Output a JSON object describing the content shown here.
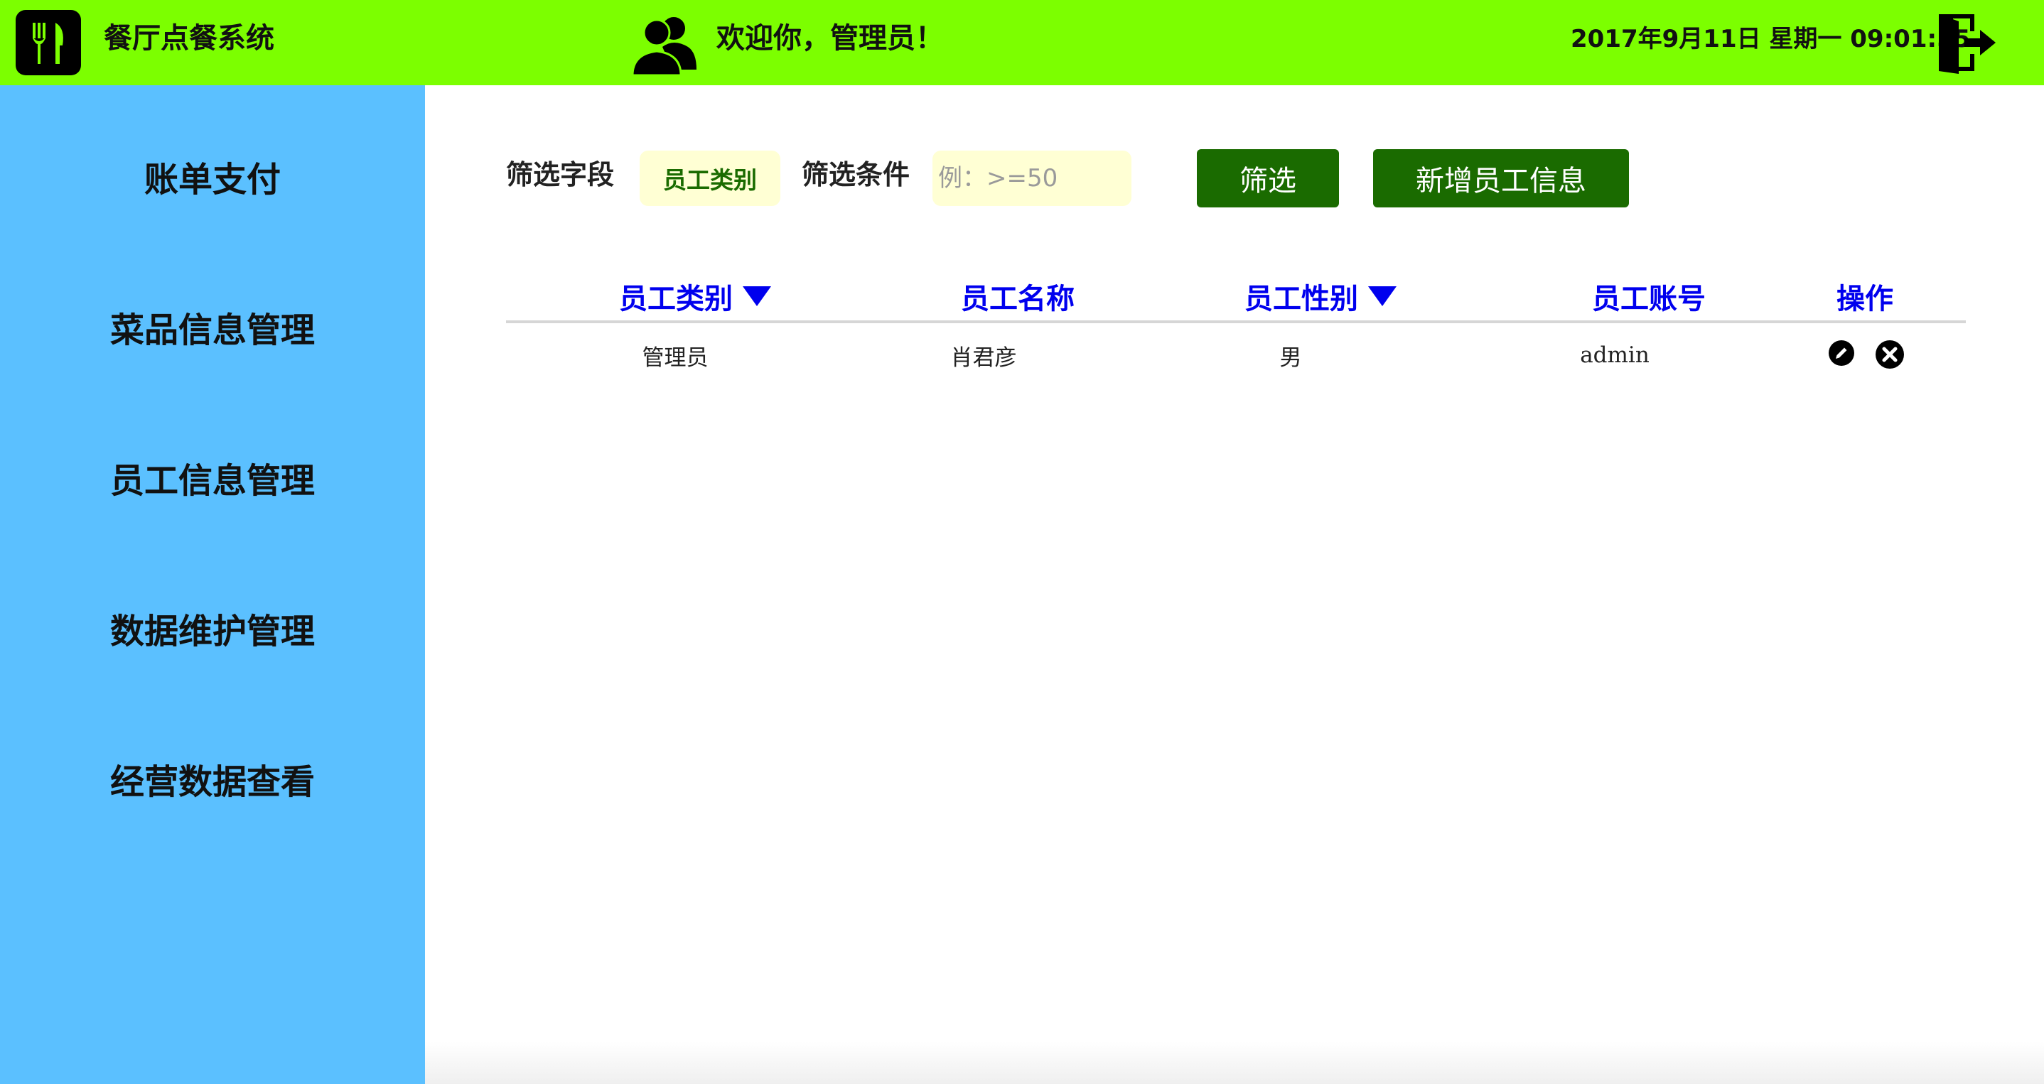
{
  "header": {
    "app_title": "餐厅点餐系统",
    "welcome": "欢迎你，管理员！",
    "datetime": "2017年9月11日 星期一 09:01:55",
    "logo_icon": "fork-knife-icon",
    "user_icon": "users-icon",
    "logout_icon": "logout-icon",
    "bg_color": "#7cff00"
  },
  "sidebar": {
    "bg_color": "#5bc0ff",
    "items": [
      {
        "label": "账单支付"
      },
      {
        "label": "菜品信息管理"
      },
      {
        "label": "员工信息管理"
      },
      {
        "label": "数据维护管理"
      },
      {
        "label": "经营数据查看"
      }
    ]
  },
  "filter": {
    "field_label": "筛选字段",
    "field_value": "员工类别",
    "condition_label": "筛选条件",
    "condition_placeholder": "例：>=50",
    "condition_value": "",
    "filter_button": "筛选",
    "add_button": "新增员工信息"
  },
  "table": {
    "columns": [
      {
        "label": "员工类别",
        "sortable": true
      },
      {
        "label": "员工名称",
        "sortable": false
      },
      {
        "label": "员工性别",
        "sortable": true
      },
      {
        "label": "员工账号",
        "sortable": false
      },
      {
        "label": "操作",
        "sortable": false
      }
    ],
    "rows": [
      {
        "type": "管理员",
        "name": "肖君彦",
        "gender": "男",
        "account": "admin"
      }
    ],
    "row_actions": [
      "edit-icon",
      "delete-icon"
    ]
  }
}
